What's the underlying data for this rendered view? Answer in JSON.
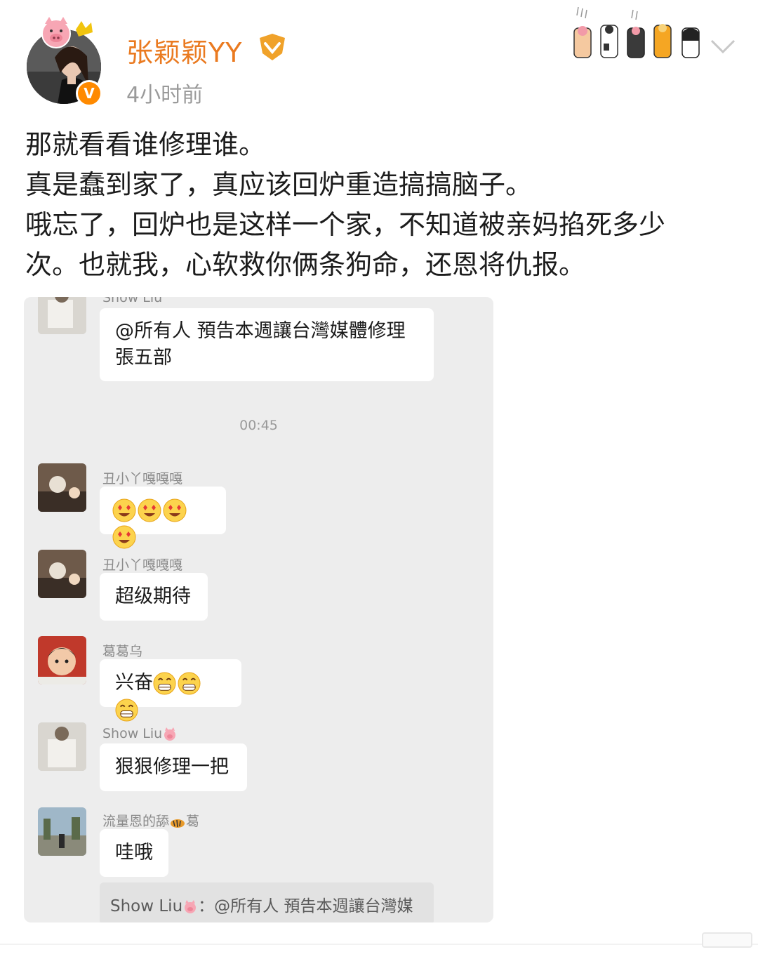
{
  "post": {
    "user_name": "张颖颖YY",
    "time": "4小时前",
    "verified_mark": "V",
    "text_lines": [
      "那就看看谁修理谁。",
      "真是蠢到家了，真应该回炉重造搞搞脑子。",
      "哦忘了，回炉也是这样一个家，不知道被亲妈掐死多少",
      "次。也就我，心软救你俩条狗命，还恩将仇报。"
    ],
    "colors": {
      "name": "#ea7a20",
      "badge": "#ff8a00"
    },
    "icons": [
      "pig-icon",
      "crown-badge-icon",
      "paw-decoration-icon",
      "chevron-down-icon"
    ]
  },
  "chat": {
    "top_sender": "Show Liu",
    "messages": [
      {
        "sender": "Show Liu",
        "text_line1": "@所有人  預告本週讓台灣媒體修理",
        "text_line2": "張五部"
      },
      {
        "sender": "丑小丫嘎嘎嘎",
        "emoji": [
          "heart-eyes-emoji",
          "heart-eyes-emoji",
          "heart-eyes-emoji",
          "heart-eyes-emoji"
        ]
      },
      {
        "sender": "丑小丫嘎嘎嘎",
        "text": "超级期待"
      },
      {
        "sender": "葛葛乌",
        "text": "兴奋",
        "emoji": [
          "grin-emoji",
          "grin-emoji",
          "grin-emoji"
        ]
      },
      {
        "sender": "Show Liu",
        "text": "狠狠修理一把"
      },
      {
        "sender": "流量恩的舔",
        "sender_suffix": "葛",
        "text": "哇哦"
      }
    ],
    "timestamp": "00:45",
    "quote": {
      "sender": "Show Liu",
      "text": "：@所有人 預告本週讓台灣媒"
    }
  }
}
